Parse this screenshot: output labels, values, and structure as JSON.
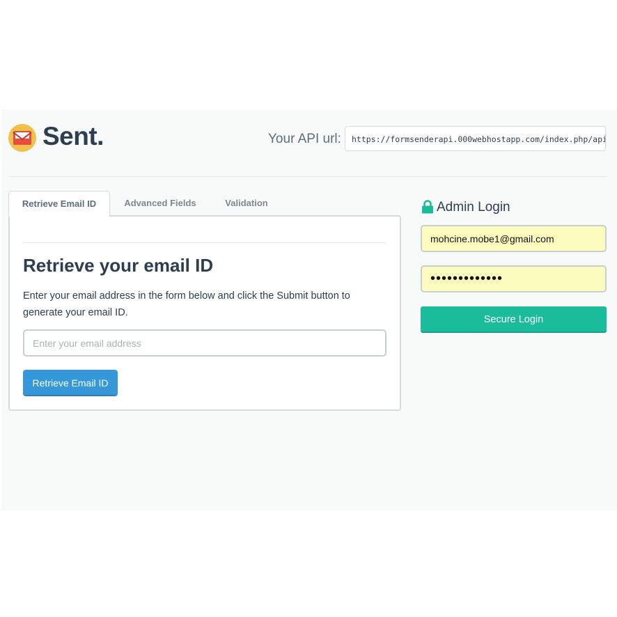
{
  "header": {
    "brand": "Sent.",
    "logo_icon": "envelope-icon",
    "api_label": "Your API url:",
    "api_url": "https://formsenderapi.000webhostapp.com/index.php/api"
  },
  "tabs": [
    {
      "label": "Retrieve Email ID",
      "active": true
    },
    {
      "label": "Advanced Fields",
      "active": false
    },
    {
      "label": "Validation",
      "active": false
    }
  ],
  "panel": {
    "title": "Retrieve your email ID",
    "description": "Enter your email address in the form below and click the Submit button to generate your email ID.",
    "email_placeholder": "Enter your email address",
    "button_label": "Retrieve Email ID"
  },
  "admin": {
    "title": "Admin Login",
    "lock_icon": "lock-icon",
    "email_value": "mohcine.mobe1@gmail.com",
    "password_value": "•••••••••••••",
    "button_label": "Secure Login"
  },
  "colors": {
    "primary": "#3498db",
    "success": "#1abc9c",
    "text": "#2c3e50",
    "autofill": "#fcfcbe"
  }
}
